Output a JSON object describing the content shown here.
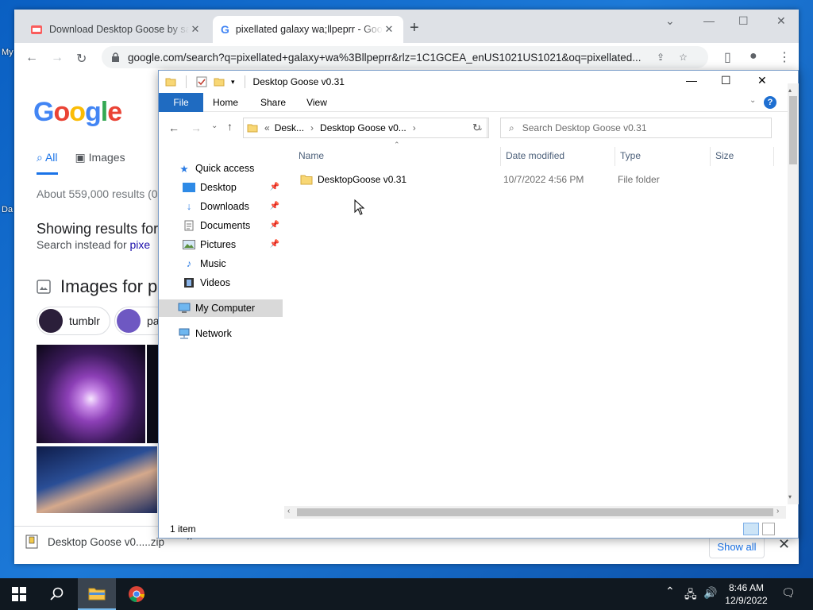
{
  "desktop": {
    "label_1": "My",
    "label_2": "Da"
  },
  "chrome": {
    "tabs": [
      {
        "title": "Download Desktop Goose by samperson",
        "close": "✕"
      },
      {
        "title": "pixellated galaxy wa;llpeprr - Google Search",
        "close": "✕"
      }
    ],
    "new_tab": "+",
    "url": "google.com/search?q=pixellated+galaxy+wa%3Bllpeprr&rlz=1C1GCEA_enUS1021US1021&oq=pixellated..."
  },
  "google": {
    "logo": "Google",
    "tab_all": "All",
    "tab_images": "Images",
    "results_count": "About 559,000 results (0",
    "showing_results": "Showing results for",
    "search_instead_prefix": "Search instead for ",
    "search_instead_link": "pixe",
    "images_heading": "Images for p",
    "chips": [
      "tumblr",
      "pa"
    ]
  },
  "download": {
    "file": "Desktop Goose v0.....zip",
    "show_all": "Show all",
    "close": "✕"
  },
  "explorer": {
    "title": "Desktop Goose v0.31",
    "ribbon": {
      "file": "File",
      "home": "Home",
      "share": "Share",
      "view": "View",
      "help": "?"
    },
    "breadcrumb": {
      "overflow": "«",
      "seg1": "Desk...",
      "seg2": "Desktop Goose v0..."
    },
    "search_placeholder": "Search Desktop Goose v0.31",
    "nav": {
      "quick_access": "Quick access",
      "desktop": "Desktop",
      "downloads": "Downloads",
      "documents": "Documents",
      "pictures": "Pictures",
      "music": "Music",
      "videos": "Videos",
      "my_computer": "My Computer",
      "network": "Network"
    },
    "columns": {
      "name": "Name",
      "date": "Date modified",
      "type": "Type",
      "size": "Size"
    },
    "rows": [
      {
        "name": "DesktopGoose v0.31",
        "date": "10/7/2022 4:56 PM",
        "type": "File folder",
        "size": ""
      }
    ],
    "status": "1 item"
  },
  "taskbar": {
    "time": "8:46 AM",
    "date": "12/9/2022"
  },
  "colors": {
    "accent": "#1f6bc1",
    "selection": "#d9d9d9",
    "taskbar": "#101820"
  }
}
